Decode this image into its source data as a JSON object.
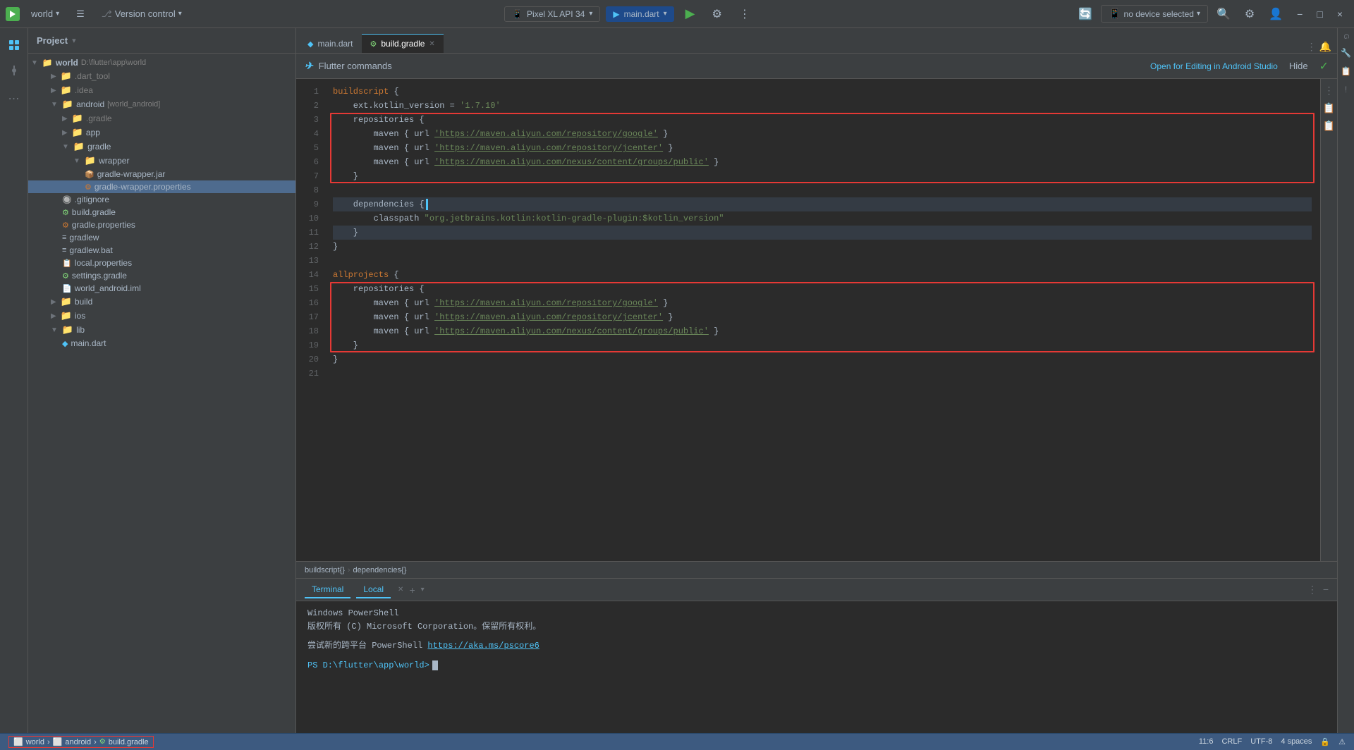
{
  "titlebar": {
    "project_name": "world",
    "vcs_label": "Version control",
    "file_label": "main.dart",
    "device_label": "Pixel XL API 34",
    "no_device_label": "no device selected",
    "run_label": "main.dart",
    "window_controls": {
      "minimize": "−",
      "maximize": "□",
      "close": "×"
    }
  },
  "project_panel": {
    "title": "Project",
    "dropdown_icon": "▾"
  },
  "tree": {
    "items": [
      {
        "label": "world",
        "path": "D:\\flutter\\app\\world",
        "level": 1,
        "type": "folder_open",
        "bold": true
      },
      {
        "label": ".dart_tool",
        "level": 2,
        "type": "folder",
        "color": "gray"
      },
      {
        "label": ".idea",
        "level": 2,
        "type": "folder",
        "color": "gray"
      },
      {
        "label": "android [world_android]",
        "level": 2,
        "type": "folder_open",
        "color": "blue"
      },
      {
        "label": ".gradle",
        "level": 3,
        "type": "folder",
        "color": "gray"
      },
      {
        "label": "app",
        "level": 3,
        "type": "folder",
        "color": "blue"
      },
      {
        "label": "gradle",
        "level": 3,
        "type": "folder_open",
        "color": "blue"
      },
      {
        "label": "wrapper",
        "level": 4,
        "type": "folder_open",
        "color": "blue"
      },
      {
        "label": "gradle-wrapper.jar",
        "level": 5,
        "type": "jar"
      },
      {
        "label": "gradle-wrapper.properties",
        "level": 5,
        "type": "props",
        "selected": true
      },
      {
        "label": ".gitignore",
        "level": 3,
        "type": "gitignore"
      },
      {
        "label": "build.gradle",
        "level": 3,
        "type": "gradle"
      },
      {
        "label": "gradle.properties",
        "level": 3,
        "type": "props"
      },
      {
        "label": "gradlew",
        "level": 3,
        "type": "text"
      },
      {
        "label": "gradlew.bat",
        "level": 3,
        "type": "text"
      },
      {
        "label": "local.properties",
        "level": 3,
        "type": "props"
      },
      {
        "label": "settings.gradle",
        "level": 3,
        "type": "gradle"
      },
      {
        "label": "world_android.iml",
        "level": 3,
        "type": "iml"
      },
      {
        "label": "build",
        "level": 2,
        "type": "folder",
        "color": "orange"
      },
      {
        "label": "ios",
        "level": 2,
        "type": "folder",
        "color": "blue"
      },
      {
        "label": "lib",
        "level": 2,
        "type": "folder_open",
        "color": "blue"
      },
      {
        "label": "main.dart",
        "level": 3,
        "type": "dart"
      }
    ]
  },
  "tabs": [
    {
      "label": "main.dart",
      "type": "dart",
      "active": false
    },
    {
      "label": "build.gradle",
      "type": "gradle",
      "active": true,
      "closeable": true
    }
  ],
  "flutter_bar": {
    "title": "Flutter commands",
    "open_link_label": "Open for Editing in Android Studio",
    "hide_label": "Hide"
  },
  "editor": {
    "lines": [
      {
        "num": 1,
        "text": "buildscript {",
        "indent": 0
      },
      {
        "num": 2,
        "text": "    ext.kotlin_version = '1.7.10'",
        "indent": 1
      },
      {
        "num": 3,
        "text": "    repositories {",
        "indent": 1,
        "red_top": true
      },
      {
        "num": 4,
        "text": "        maven { url 'https://maven.aliyun.com/repository/google' }",
        "indent": 2,
        "red_mid": true
      },
      {
        "num": 5,
        "text": "        maven { url 'https://maven.aliyun.com/repository/jcenter' }",
        "indent": 2,
        "red_mid": true
      },
      {
        "num": 6,
        "text": "        maven { url 'https://maven.aliyun.com/nexus/content/groups/public' }",
        "indent": 2,
        "red_mid": true
      },
      {
        "num": 7,
        "text": "    }",
        "indent": 1,
        "red_bot": true
      },
      {
        "num": 8,
        "text": ""
      },
      {
        "num": 9,
        "text": "    dependencies {",
        "indent": 1,
        "highlight": true
      },
      {
        "num": 10,
        "text": "        classpath \"org.jetbrains.kotlin:kotlin-gradle-plugin:$kotlin_version\"",
        "indent": 2
      },
      {
        "num": 11,
        "text": "    }",
        "indent": 1,
        "highlight": true
      },
      {
        "num": 12,
        "text": "}"
      },
      {
        "num": 13,
        "text": ""
      },
      {
        "num": 14,
        "text": "allprojects {"
      },
      {
        "num": 15,
        "text": "    repositories {",
        "indent": 1,
        "red_top2": true
      },
      {
        "num": 16,
        "text": "        maven { url 'https://maven.aliyun.com/repository/google' }",
        "indent": 2,
        "red_mid2": true
      },
      {
        "num": 17,
        "text": "        maven { url 'https://maven.aliyun.com/repository/jcenter' }",
        "indent": 2,
        "red_mid2": true
      },
      {
        "num": 18,
        "text": "        maven { url 'https://maven.aliyun.com/nexus/content/groups/public' }",
        "indent": 2,
        "red_mid2": true
      },
      {
        "num": 19,
        "text": "    }",
        "indent": 1,
        "red_bot2": true
      },
      {
        "num": 20,
        "text": "}"
      },
      {
        "num": 21,
        "text": ""
      }
    ],
    "urls": {
      "google": "https://maven.aliyun.com/repository/google",
      "jcenter": "https://maven.aliyun.com/repository/jcenter",
      "public": "https://maven.aliyun.com/nexus/content/groups/public"
    }
  },
  "breadcrumb": {
    "items": [
      "buildscript{}",
      "dependencies{}"
    ]
  },
  "terminal": {
    "tab_label": "Terminal",
    "local_label": "Local",
    "title": "Windows PowerShell",
    "copyright": "版权所有 (C) Microsoft Corporation。保留所有权利。",
    "tip": "尝试新的跨平台 PowerShell",
    "tip_link": "https://aka.ms/pscore6",
    "prompt": "PS D:\\flutter\\app\\world>"
  },
  "status_bar": {
    "path_items": [
      "world",
      "android",
      "build.gradle"
    ],
    "position": "11:6",
    "line_ending": "CRLF",
    "encoding": "UTF-8",
    "indent": "4 spaces"
  },
  "icons": {
    "folder": "📁",
    "folder_open": "📂",
    "dart_file": "◆",
    "gradle_file": "🔧",
    "settings_file": "⚙",
    "chevron_right": "▶",
    "chevron_down": "▼",
    "flutter_arrow": "➤"
  }
}
